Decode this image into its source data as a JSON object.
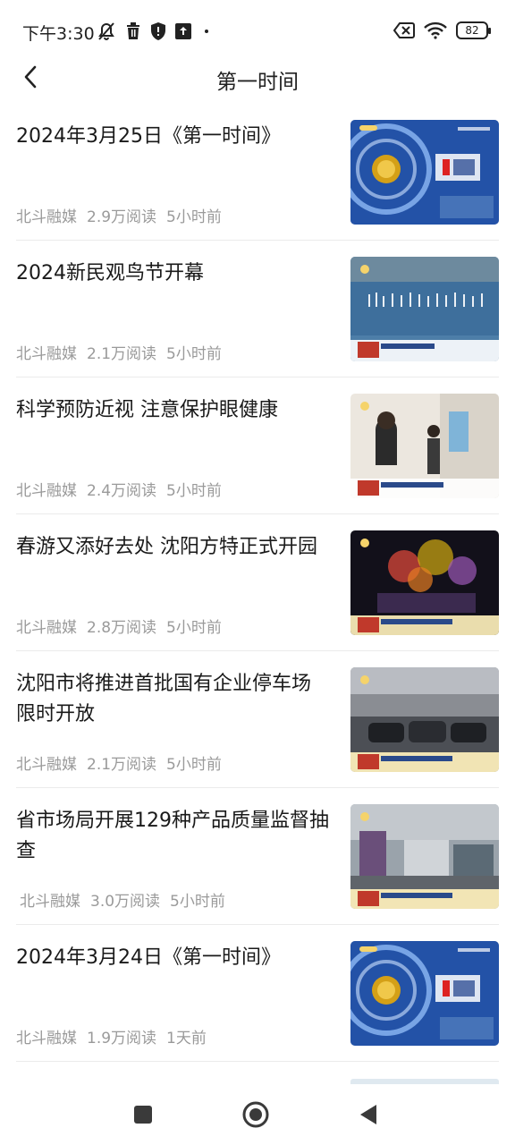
{
  "status_bar": {
    "time": "下午3:30",
    "battery": "82",
    "icons": [
      "mute-icon",
      "trash-icon",
      "shield-icon",
      "upload-icon",
      "dot-icon",
      "sim-off-icon",
      "wifi-icon",
      "battery-icon"
    ]
  },
  "header": {
    "title": "第一时间",
    "back_icon": "chevron-left-icon"
  },
  "news": [
    {
      "title": "2024年3月25日《第一时间》",
      "source": "北斗融媒",
      "reads": "2.9万阅读",
      "time": "5小时前",
      "thumb": "studio"
    },
    {
      "title": "2024新民观鸟节开幕",
      "source": "北斗融媒",
      "reads": "2.1万阅读",
      "time": "5小时前",
      "thumb": "birds"
    },
    {
      "title": "科学预防近视 注意保护眼健康",
      "source": "北斗融媒",
      "reads": "2.4万阅读",
      "time": "5小时前",
      "thumb": "clinic"
    },
    {
      "title": "春游又添好去处 沈阳方特正式开园",
      "source": "北斗融媒",
      "reads": "2.8万阅读",
      "time": "5小时前",
      "thumb": "fireworks"
    },
    {
      "title": "沈阳市将推进首批国有企业停车场限时开放",
      "source": "北斗融媒",
      "reads": "2.1万阅读",
      "time": "5小时前",
      "thumb": "parking"
    },
    {
      "title": "省市场局开展129种产品质量监督抽查",
      "source": "北斗融媒",
      "reads": "3.0万阅读",
      "time": "5小时前",
      "thumb": "street"
    },
    {
      "title": "2024年3月24日《第一时间》",
      "source": "北斗融媒",
      "reads": "1.9万阅读",
      "time": "1天前",
      "thumb": "studio"
    }
  ],
  "nav_bar": {
    "recent_icon": "square-icon",
    "home_icon": "circle-icon",
    "back_icon": "triangle-back-icon"
  }
}
